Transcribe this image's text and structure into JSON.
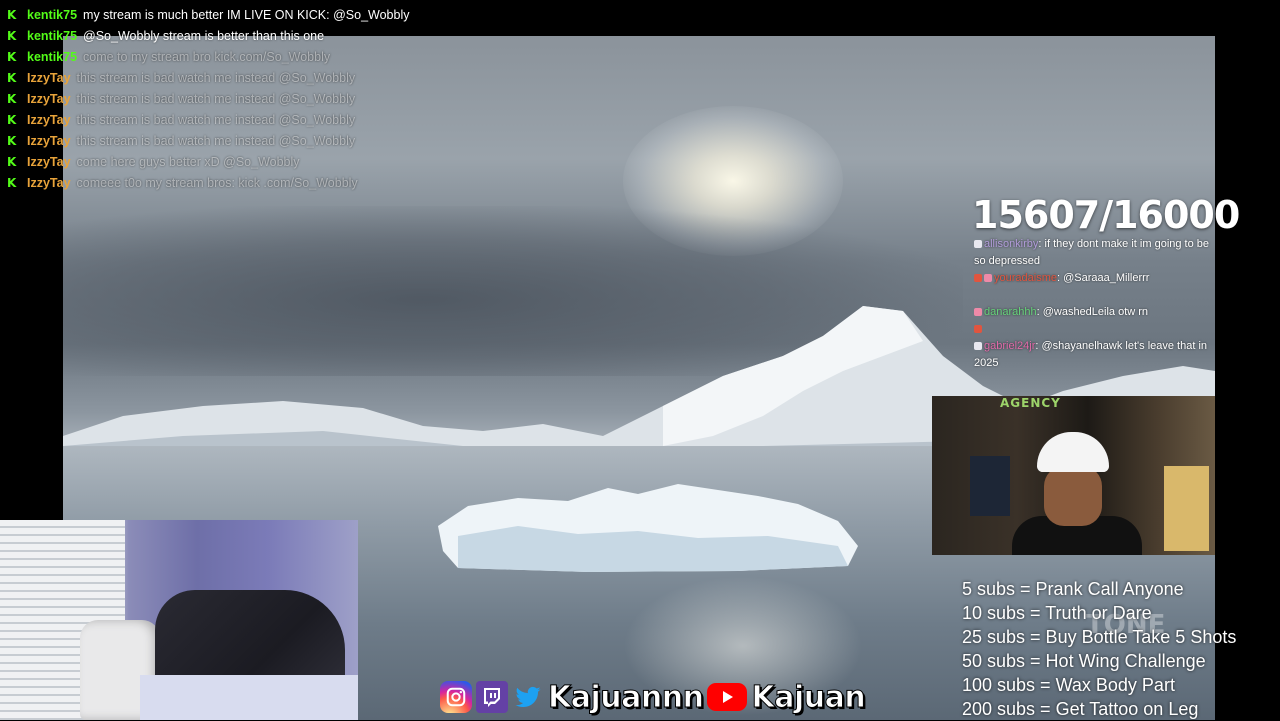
{
  "chat": [
    {
      "user": "kentik75",
      "message": "my stream is much better IM LIVE ON KICK: @So_Wobbly",
      "user_color": "#53fc18",
      "faded": false
    },
    {
      "user": "kentik75",
      "message": "@So_Wobbly stream is better than this one",
      "user_color": "#53fc18",
      "faded": false
    },
    {
      "user": "kentik75",
      "message": "come to my stream bro kick.com/So_Wobbly",
      "user_color": "#53fc18",
      "faded": true
    },
    {
      "user": "IzzyTay",
      "message": "this stream is bad watch me instead @So_Wobbly",
      "user_color": "#e8a33a",
      "faded": true
    },
    {
      "user": "IzzyTay",
      "message": "this stream is bad watch me instead @So_Wobbly",
      "user_color": "#e8a33a",
      "faded": true
    },
    {
      "user": "IzzyTay",
      "message": "this stream is bad watch me instead @So_Wobbly",
      "user_color": "#e8a33a",
      "faded": true
    },
    {
      "user": "IzzyTay",
      "message": "this stream is bad watch me instead @So_Wobbly",
      "user_color": "#e8a33a",
      "faded": true
    },
    {
      "user": "IzzyTay",
      "message": "come here guys better xD @So_Wobbly",
      "user_color": "#e8a33a",
      "faded": true
    },
    {
      "user": "IzzyTay",
      "message": "comeee t0o my stream bros: kick .com/So_Wobbly",
      "user_color": "#e8a33a",
      "faded": true
    }
  ],
  "kick_icon": "kick-logo-icon",
  "goal": {
    "text": "15607/16000",
    "current": 15607,
    "target": 16000
  },
  "right_chat": [
    {
      "user": "allisonkirby",
      "message": ": if they dont make it im going to be so depressed",
      "user_color": "#b39ddb"
    },
    {
      "user": "youradaisme",
      "message": ": @Saraaa_Millerrr",
      "user_color": "#e0553f"
    },
    {
      "user": "danarahhh",
      "message": ": @washedLeila otw rn",
      "user_color": "#66d17a"
    },
    {
      "user": "gabriel24jr",
      "message": ": @shayanelhawk let's leave that in 2025",
      "user_color": "#e06aa8"
    }
  ],
  "sub_goals": [
    "5 subs =  Prank Call Anyone",
    "10 subs = Truth or Dare",
    "25 subs = Buy Bottle Take 5 Shots",
    "50 subs = Hot Wing Challenge",
    "100 subs = Wax Body Part",
    "200 subs = Get Tattoo on Leg"
  ],
  "socials": {
    "handle_1": "Kajuannn",
    "handle_2": "Kajuan",
    "icons": [
      "instagram-icon",
      "twitch-icon",
      "twitter-icon",
      "youtube-icon"
    ]
  },
  "webcam_sign": "AGENCY",
  "watermark": "TONE"
}
